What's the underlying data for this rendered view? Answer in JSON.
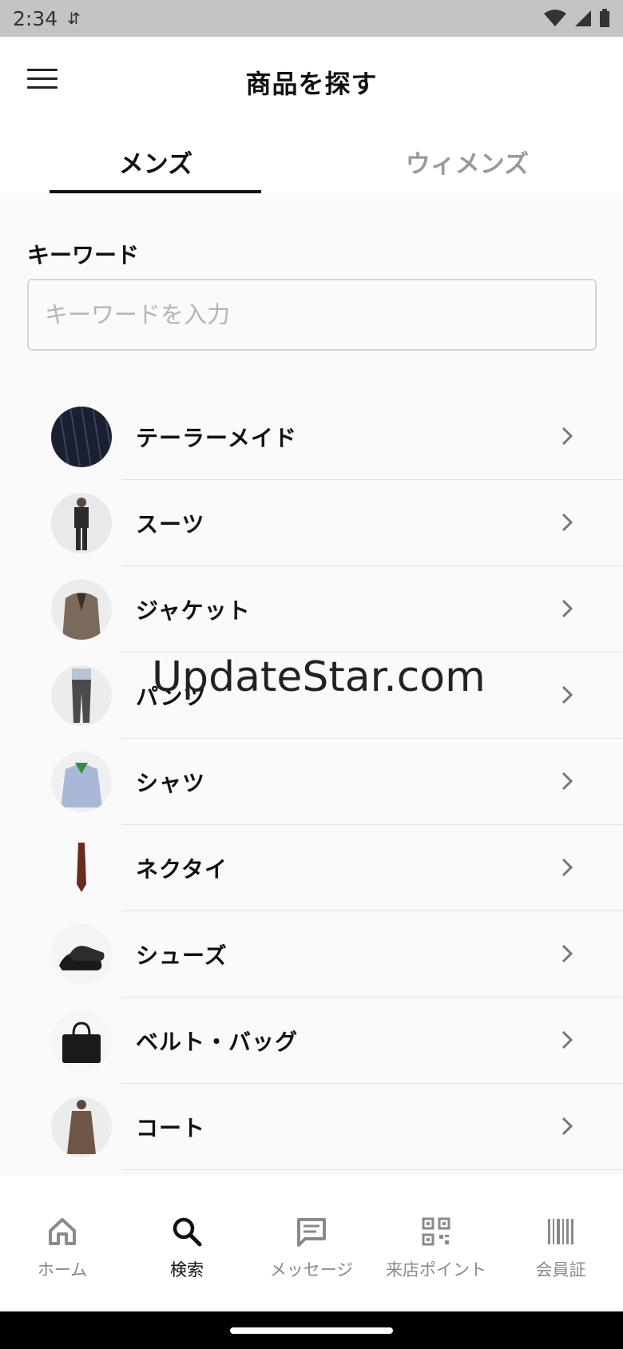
{
  "status": {
    "time": "2:34",
    "sync_icon": "sync-icon"
  },
  "header": {
    "title": "商品を探す"
  },
  "tabs": [
    {
      "label": "メンズ",
      "active": true
    },
    {
      "label": "ウィメンズ",
      "active": false
    }
  ],
  "search": {
    "label": "キーワード",
    "placeholder": "キーワードを入力",
    "value": ""
  },
  "categories": [
    {
      "label": "テーラーメイド",
      "thumb": "fabric"
    },
    {
      "label": "スーツ",
      "thumb": "suit"
    },
    {
      "label": "ジャケット",
      "thumb": "jacket"
    },
    {
      "label": "パンツ",
      "thumb": "pants"
    },
    {
      "label": "シャツ",
      "thumb": "shirt"
    },
    {
      "label": "ネクタイ",
      "thumb": "tie"
    },
    {
      "label": "シューズ",
      "thumb": "shoes"
    },
    {
      "label": "ベルト・バッグ",
      "thumb": "bag"
    },
    {
      "label": "コート",
      "thumb": "coat"
    }
  ],
  "watermark": "UpdateStar.com",
  "nav": [
    {
      "label": "ホーム",
      "icon": "home-icon",
      "active": false
    },
    {
      "label": "検索",
      "icon": "search-icon",
      "active": true
    },
    {
      "label": "メッセージ",
      "icon": "message-icon",
      "active": false
    },
    {
      "label": "来店ポイント",
      "icon": "qr-code-icon",
      "active": false
    },
    {
      "label": "会員証",
      "icon": "barcode-icon",
      "active": false
    }
  ],
  "colors": {
    "active": "#111111",
    "inactive": "#8a8a8a",
    "divider": "#e4e4e4"
  }
}
